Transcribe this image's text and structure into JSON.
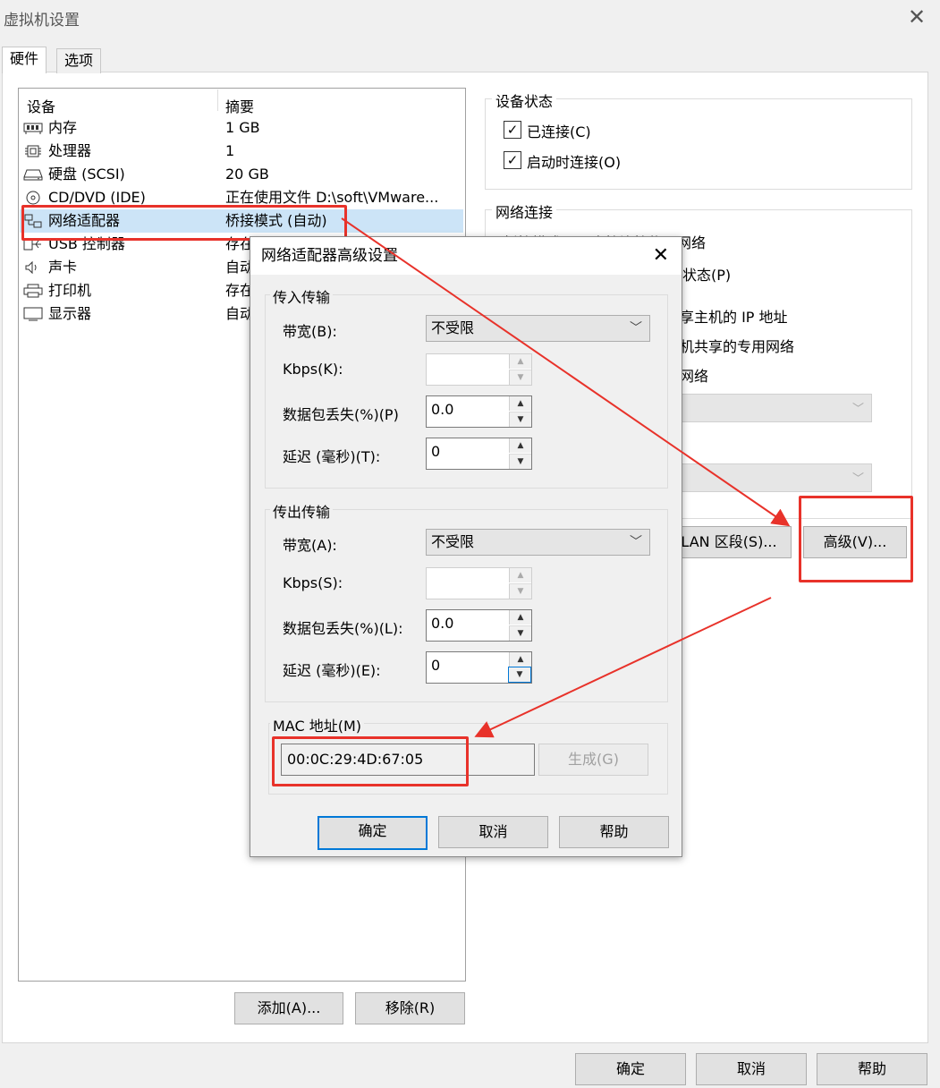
{
  "window": {
    "title": "虚拟机设置",
    "close": "✕"
  },
  "tabs": [
    {
      "label": "硬件"
    },
    {
      "label": "选项"
    }
  ],
  "device_list": {
    "headers": {
      "device": "设备",
      "summary": "摘要"
    },
    "rows": [
      {
        "icon": "memory-icon",
        "name": "内存",
        "summary": "1 GB"
      },
      {
        "icon": "cpu-icon",
        "name": "处理器",
        "summary": "1"
      },
      {
        "icon": "harddisk-icon",
        "name": "硬盘 (SCSI)",
        "summary": "20 GB"
      },
      {
        "icon": "cd-dvd-icon",
        "name": "CD/DVD (IDE)",
        "summary": "正在使用文件 D:\\soft\\VMware..."
      },
      {
        "icon": "network-adapter-icon",
        "name": "网络适配器",
        "summary": "桥接模式 (自动)"
      },
      {
        "icon": "usb-icon",
        "name": "USB 控制器",
        "summary": "存在"
      },
      {
        "icon": "speaker-icon",
        "name": "声卡",
        "summary": "自动"
      },
      {
        "icon": "printer-icon",
        "name": "打印机",
        "summary": "存在"
      },
      {
        "icon": "monitor-icon",
        "name": "显示器",
        "summary": "自动"
      }
    ]
  },
  "device_status": {
    "label": "设备状态",
    "connected": {
      "label": "已连接(C)",
      "checked": true
    },
    "connect_on_start": {
      "label": "启动时连接(O)",
      "checked": true
    }
  },
  "network": {
    "label": "网络连接",
    "bridged_fragment": "桥接模式(B): 直接连接物理网络",
    "replicate_fragment": "状态(P)",
    "nat_fragment": "享主机的 IP 地址",
    "hostonly_fragment": "机共享的专用网络",
    "custom_fragment": "网络",
    "lan_segment_button": "LAN 区段(S)...",
    "advanced_button": "高级(V)..."
  },
  "bottom_buttons": {
    "add": "添加(A)...",
    "remove": "移除(R)"
  },
  "footer_buttons": {
    "ok": "确定",
    "cancel": "取消",
    "help": "帮助"
  },
  "dialog": {
    "title": "网络适配器高级设置",
    "close": "✕",
    "incoming": {
      "label": "传入传输",
      "bandwidth_label": "带宽(B):",
      "bandwidth_value": "不受限",
      "kbps_label": "Kbps(K):",
      "kbps_value": "",
      "loss_label": "数据包丢失(%)(P)",
      "loss_value": "0.0",
      "latency_label": "延迟 (毫秒)(T):",
      "latency_value": "0"
    },
    "outgoing": {
      "label": "传出传输",
      "bandwidth_label": "带宽(A):",
      "bandwidth_value": "不受限",
      "kbps_label": "Kbps(S):",
      "kbps_value": "",
      "loss_label": "数据包丢失(%)(L):",
      "loss_value": "0.0",
      "latency_label": "延迟 (毫秒)(E):",
      "latency_value": "0"
    },
    "mac": {
      "label": "MAC 地址(M)",
      "value": "00:0C:29:4D:67:05",
      "generate_button": "生成(G)"
    },
    "buttons": {
      "ok": "确定",
      "cancel": "取消",
      "help": "帮助"
    }
  },
  "annotation_color": "#e8322a",
  "selection_color": "#cce4f7"
}
